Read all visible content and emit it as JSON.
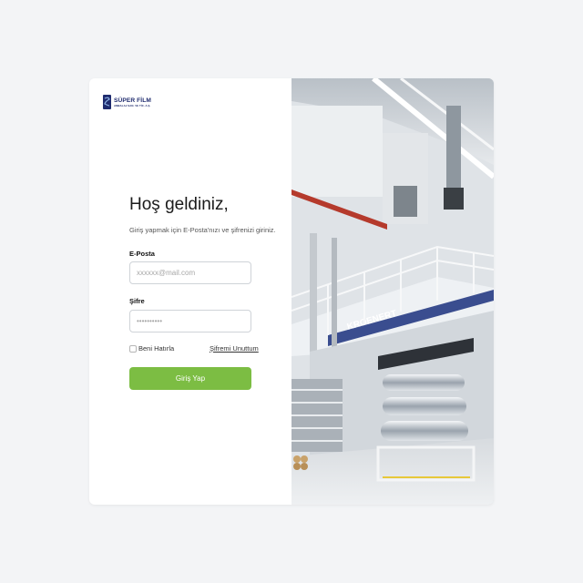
{
  "brand": {
    "name": "SÜPER FİLM",
    "sub": "AMBALAJ SAN. VE TİC. A.Ş."
  },
  "login": {
    "title": "Hoş geldiniz,",
    "subtitle": "Giriş yapmak için E-Posta'nızı ve şifrenizi giriniz.",
    "email_label": "E-Posta",
    "email_placeholder": "xxxxxx@mail.com",
    "password_label": "Şifre",
    "password_placeholder": "••••••••••",
    "remember_label": "Beni Hatırla",
    "forgot_label": "Şifremi Unuttum",
    "submit_label": "Giriş Yap"
  },
  "photo": {
    "machine_text": "KROENERT"
  },
  "colors": {
    "accent": "#7cbd43",
    "brand": "#1f2b6e",
    "background": "#f3f4f6"
  }
}
